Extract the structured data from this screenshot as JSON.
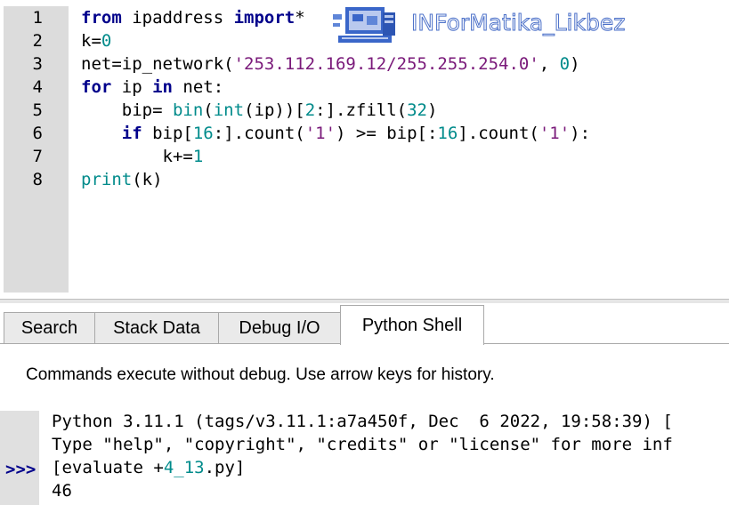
{
  "editor": {
    "line_numbers": [
      "1",
      "2",
      "3",
      "4",
      "5",
      "6",
      "7",
      "8"
    ],
    "lines": [
      [
        {
          "t": "from",
          "c": "kw"
        },
        {
          "t": " ipaddress ",
          "c": ""
        },
        {
          "t": "import",
          "c": "kw"
        },
        {
          "t": "*",
          "c": ""
        }
      ],
      [
        {
          "t": "k=",
          "c": ""
        },
        {
          "t": "0",
          "c": "num"
        }
      ],
      [
        {
          "t": "net=ip_network(",
          "c": ""
        },
        {
          "t": "'253.112.169.12/255.255.254.0'",
          "c": "str"
        },
        {
          "t": ", ",
          "c": ""
        },
        {
          "t": "0",
          "c": "num"
        },
        {
          "t": ")",
          "c": ""
        }
      ],
      [
        {
          "t": "for",
          "c": "kw"
        },
        {
          "t": " ip ",
          "c": ""
        },
        {
          "t": "in",
          "c": "kw"
        },
        {
          "t": " net:",
          "c": ""
        }
      ],
      [
        {
          "t": "    bip= ",
          "c": ""
        },
        {
          "t": "bin",
          "c": "bi"
        },
        {
          "t": "(",
          "c": ""
        },
        {
          "t": "int",
          "c": "bi"
        },
        {
          "t": "(ip))[",
          "c": ""
        },
        {
          "t": "2",
          "c": "num"
        },
        {
          "t": ":].zfill(",
          "c": ""
        },
        {
          "t": "32",
          "c": "num"
        },
        {
          "t": ")",
          "c": ""
        }
      ],
      [
        {
          "t": "    ",
          "c": ""
        },
        {
          "t": "if",
          "c": "kw"
        },
        {
          "t": " bip[",
          "c": ""
        },
        {
          "t": "16",
          "c": "num"
        },
        {
          "t": ":].count(",
          "c": ""
        },
        {
          "t": "'1'",
          "c": "str"
        },
        {
          "t": ") >= bip[:",
          "c": ""
        },
        {
          "t": "16",
          "c": "num"
        },
        {
          "t": "].count(",
          "c": ""
        },
        {
          "t": "'1'",
          "c": "str"
        },
        {
          "t": "):",
          "c": ""
        }
      ],
      [
        {
          "t": "        k+=",
          "c": ""
        },
        {
          "t": "1",
          "c": "num"
        }
      ],
      [
        {
          "t": "print",
          "c": "bi"
        },
        {
          "t": "(k)",
          "c": ""
        }
      ]
    ]
  },
  "watermark": {
    "text": "INForMatika_Likbez",
    "icon": "computer-logo-icon"
  },
  "tabs": [
    {
      "label": "Search",
      "active": false
    },
    {
      "label": "Stack Data",
      "active": false
    },
    {
      "label": "Debug I/O",
      "active": false
    },
    {
      "label": "Python Shell",
      "active": true
    }
  ],
  "shell": {
    "hint": "Commands execute without debug.  Use arrow keys for history.",
    "prompt": ">>>",
    "line1": "Python 3.11.1 (tags/v3.11.1:a7a450f, Dec  6 2022, 19:58:39) [",
    "line2": "Type \"help\", \"copyright\", \"credits\" or \"license\" for more inf",
    "line3_prefix": "[evaluate +",
    "line3_file": "4_13",
    "line3_suffix": ".py]",
    "output": "46"
  },
  "colors": {
    "keyword": "#00008b",
    "string": "#7a1a7a",
    "number": "#008b8b"
  }
}
